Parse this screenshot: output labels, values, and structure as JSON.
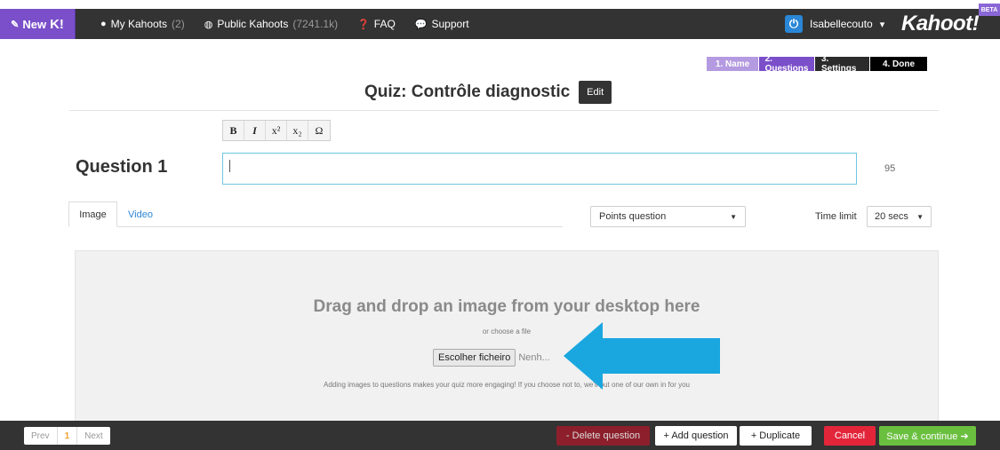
{
  "nav": {
    "new_label": "New",
    "new_mark": "K!",
    "my_kahoots_label": "My Kahoots",
    "my_kahoots_count": "(2)",
    "public_kahoots_label": "Public Kahoots",
    "public_kahoots_count": "(7241.1k)",
    "faq_label": "FAQ",
    "support_label": "Support",
    "username": "Isabellecouto",
    "logo": "Kahoot!",
    "beta": "BETA"
  },
  "steps": [
    {
      "label": "1. Name"
    },
    {
      "label": "2. Questions"
    },
    {
      "label": "3. Settings"
    },
    {
      "label": "4. Done"
    }
  ],
  "quiz": {
    "title": "Quiz: Contrôle diagnostic",
    "edit_label": "Edit"
  },
  "toolbar": {
    "bold": "B",
    "italic": "I",
    "superscript": "x²",
    "subscript": "x₂",
    "omega": "Ω"
  },
  "question": {
    "label": "Question 1",
    "value": "",
    "char_count": "95"
  },
  "tabs": {
    "image": "Image",
    "video": "Video"
  },
  "points_select": {
    "selected": "Points question"
  },
  "time_limit": {
    "label": "Time limit",
    "selected": "20 secs"
  },
  "dropzone": {
    "title": "Drag and drop an image from your desktop here",
    "subtitle": "or choose a file",
    "file_button": "Escolher ficheiro",
    "file_status": "Nenh...",
    "hint": "Adding images to questions makes your quiz more engaging! If you choose not to, we'll put one of our own in for you"
  },
  "pager": {
    "prev": "Prev",
    "current": "1",
    "next": "Next"
  },
  "actions": {
    "delete": "- Delete question",
    "add": "+ Add question",
    "duplicate": "+ Duplicate",
    "cancel": "Cancel",
    "save": "Save & continue ➔"
  },
  "colors": {
    "accent_purple": "#7a4fc9",
    "focus_blue": "#6fc7e0",
    "arrow_blue": "#1aa7e0",
    "cancel_red": "#e3253a",
    "save_green": "#6bbf3f"
  }
}
